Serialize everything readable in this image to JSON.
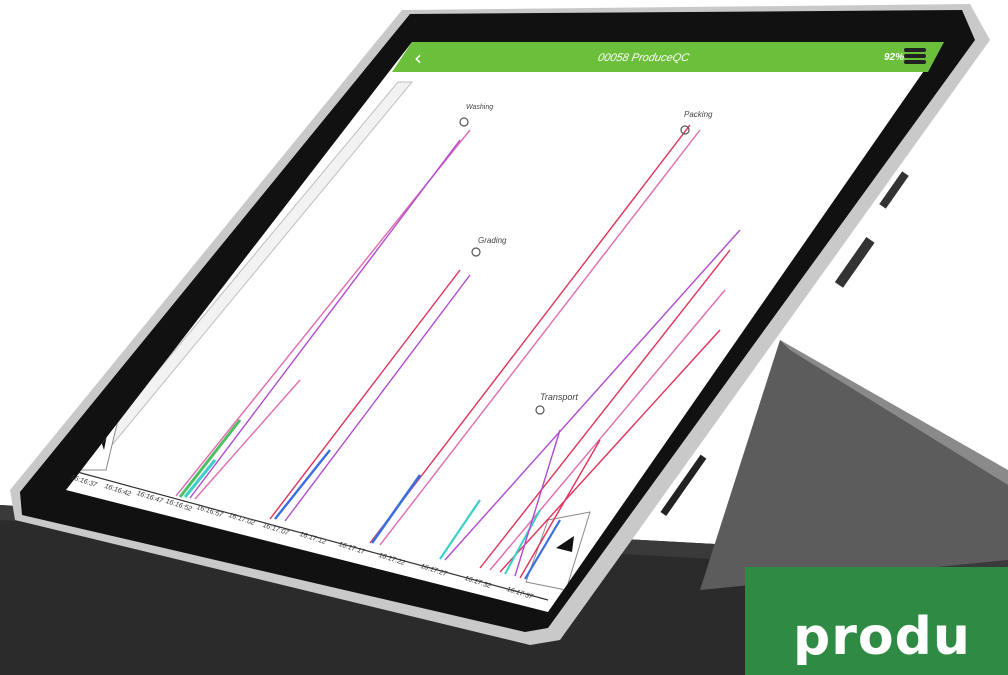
{
  "app": {
    "title": "00058 ProduceQC",
    "battery": "92%",
    "back_icon": "chevron-left-icon",
    "battery_icon": "battery-icon",
    "accent": "#6cbf3a"
  },
  "chart": {
    "x_ticks": [
      "16:16:37",
      "16:16:42",
      "16:16:47",
      "16:16:52",
      "16:16:57",
      "16:17:02",
      "16:17:07",
      "16:17:12",
      "16:17:17",
      "16:17:22",
      "16:17:27",
      "16:17:32",
      "16:17:37"
    ],
    "stages": [
      {
        "label": "Washing"
      },
      {
        "label": "Packing"
      },
      {
        "label": "Grading"
      },
      {
        "label": "Transport"
      }
    ],
    "series_colors": [
      "#e0315a",
      "#b04ad0",
      "#3a6fe0",
      "#3ad0c8",
      "#4ac060",
      "#e06ab0"
    ]
  },
  "brand": {
    "text": "produ",
    "color": "#2f8b44"
  }
}
